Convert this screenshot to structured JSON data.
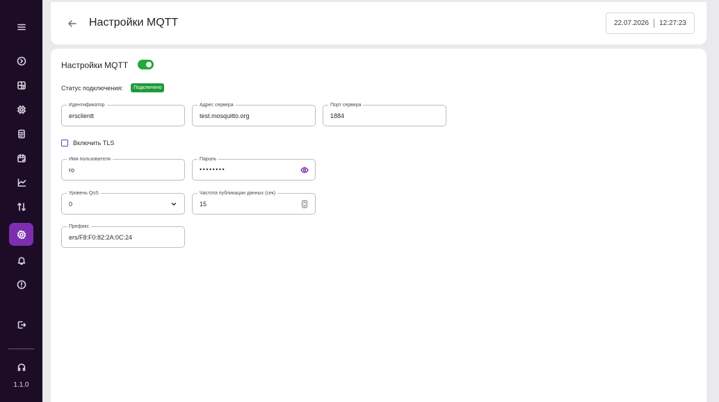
{
  "sidebar": {
    "items": [
      {
        "icon": "menu-icon",
        "active": false
      },
      {
        "icon": "play-circle-icon",
        "active": false
      },
      {
        "icon": "dashboard-icon",
        "active": false
      },
      {
        "icon": "chip-icon",
        "active": false
      },
      {
        "icon": "document-icon",
        "active": false
      },
      {
        "icon": "calendar-icon",
        "active": false
      },
      {
        "icon": "chart-icon",
        "active": false
      },
      {
        "icon": "swap-icon",
        "active": false
      },
      {
        "icon": "gear-icon",
        "active": true
      },
      {
        "icon": "bell-icon",
        "active": false
      },
      {
        "icon": "alert-circle-icon",
        "active": false
      },
      {
        "icon": "logout-icon",
        "active": false
      },
      {
        "icon": "headset-icon",
        "active": false
      }
    ],
    "version": "1.1.0"
  },
  "header": {
    "title": "Настройки MQTT",
    "date": "22.07.2026",
    "time": "12:27:23"
  },
  "main": {
    "section_title": "Настройки MQTT",
    "enabled": true,
    "status_label": "Статус подключения:",
    "status_value": "Подключено",
    "fields": {
      "identifier": {
        "label": "Идентификатор",
        "value": "ersclientt"
      },
      "server_address": {
        "label": "Адрес сервера",
        "value": "test.mosquitto.org"
      },
      "server_port": {
        "label": "Порт сервера",
        "value": "1884"
      },
      "username": {
        "label": "Имя пользователя",
        "value": "ro"
      },
      "password": {
        "label": "Пароль",
        "value": "••••••••"
      },
      "qos": {
        "label": "Уровень QoS",
        "value": "0"
      },
      "publish_rate": {
        "label": "Частота публикации данных (сек)",
        "value": "15"
      },
      "prefix": {
        "label": "Префикс",
        "value": "ers/F8:F0:82:2A:0C:24"
      }
    },
    "tls_label": "Включить TLS",
    "tls_checked": false
  },
  "colors": {
    "sidebar_bg": "#1d0c25",
    "accent": "#7b2fb0",
    "toggle_on": "#22a83b",
    "status_badge": "#1f9a38"
  }
}
